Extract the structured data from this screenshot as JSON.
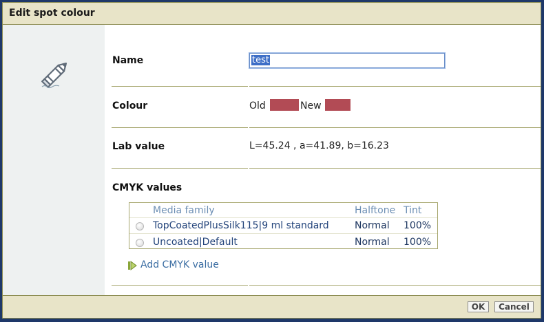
{
  "dialog": {
    "title": "Edit spot colour"
  },
  "form": {
    "name_label": "Name",
    "name_value": "test",
    "colour_label": "Colour",
    "old_label": "Old",
    "new_label": "New",
    "old_colour": "#b24b55",
    "new_colour": "#b24b55",
    "lab_label": "Lab value",
    "lab_value": "L=45.24 , a=41.89, b=16.23",
    "cmyk_label": "CMYK values"
  },
  "cmyk_table": {
    "columns": [
      "Media family",
      "Halftone",
      "Tint"
    ],
    "rows": [
      {
        "media": "TopCoatedPlusSilk115|9 ml standard",
        "halftone": "Normal",
        "tint": "100%"
      },
      {
        "media": "Uncoated|Default",
        "halftone": "Normal",
        "tint": "100%"
      }
    ]
  },
  "add_cmyk_label": "Add CMYK value",
  "buttons": {
    "ok": "OK",
    "cancel": "Cancel"
  }
}
